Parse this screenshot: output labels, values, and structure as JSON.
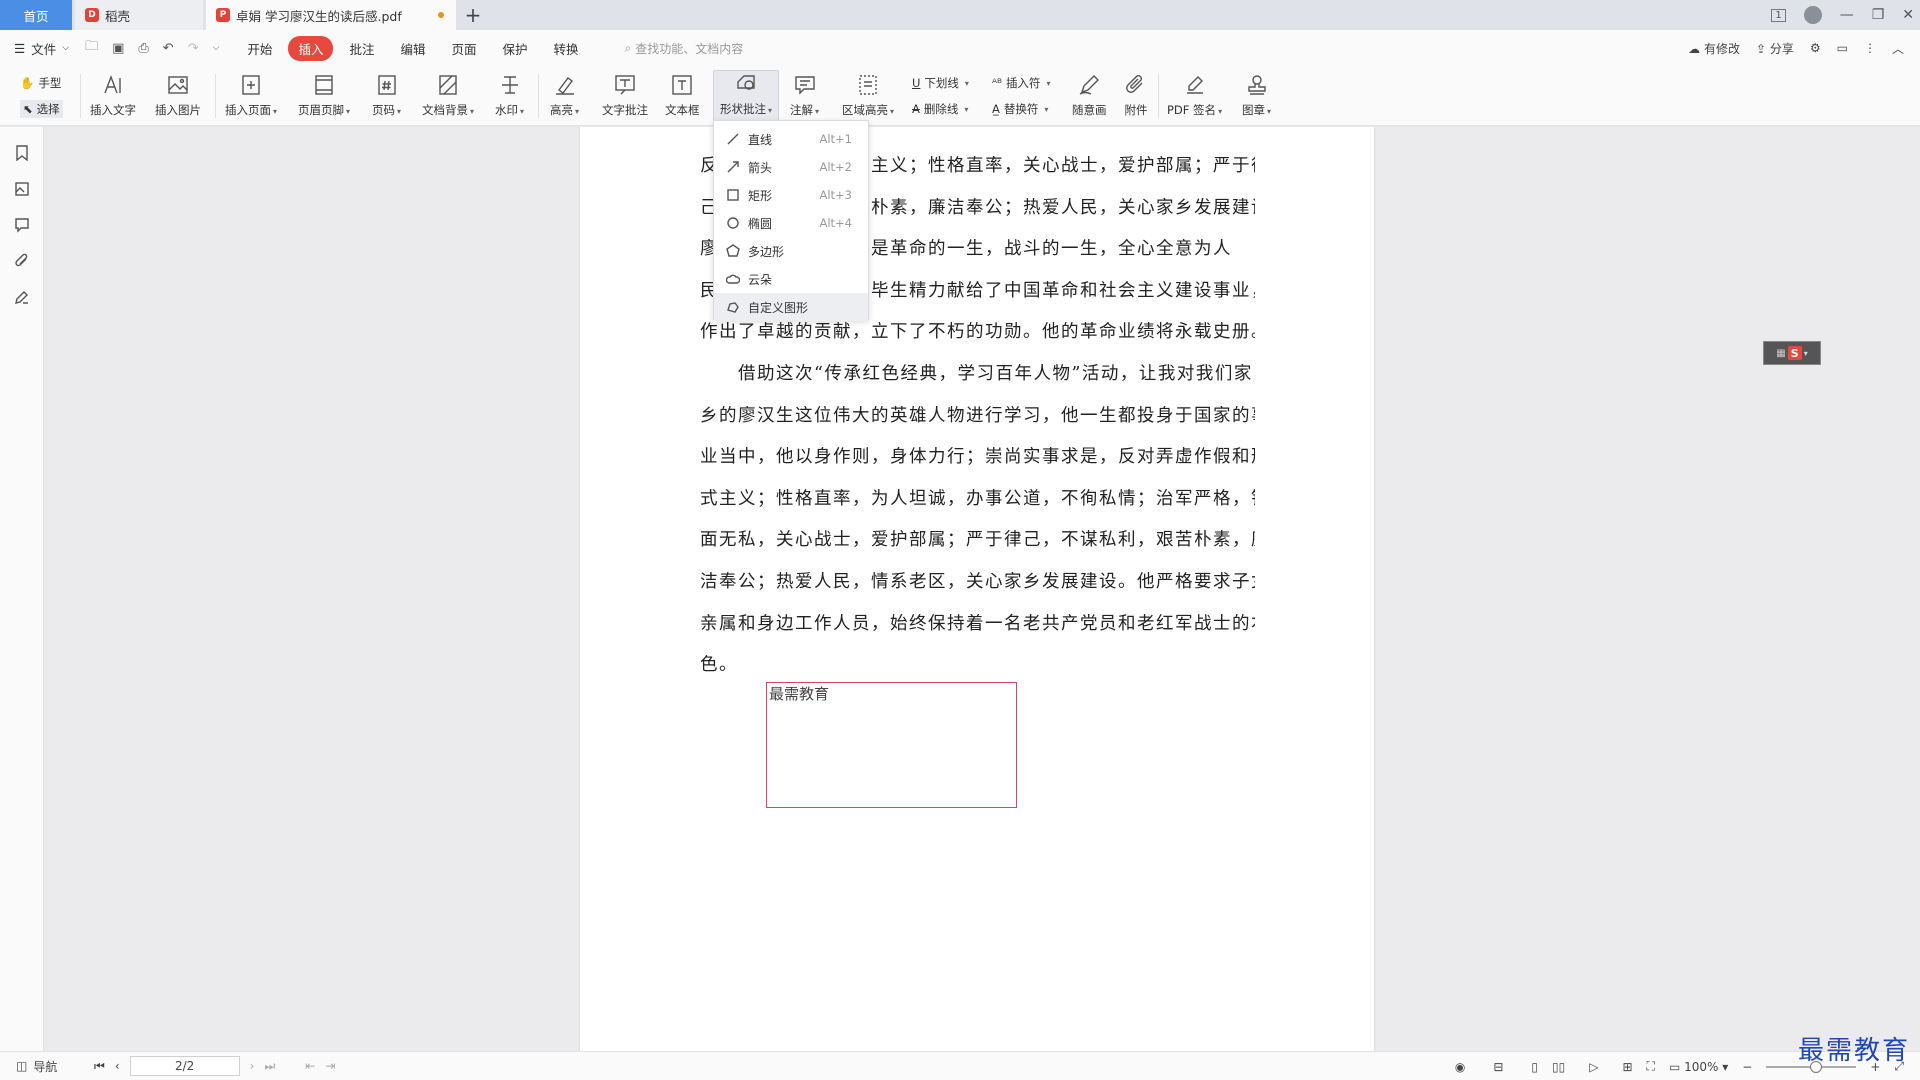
{
  "tabs": {
    "home": "首页",
    "daoke": "稻壳",
    "doc": "卓娟 学习廖汉生的读后感.pdf"
  },
  "window": {
    "page_indicator": "1"
  },
  "menubar": {
    "file": "文件",
    "tabs": [
      "开始",
      "插入",
      "批注",
      "编辑",
      "页面",
      "保护",
      "转换"
    ],
    "active_tab": "插入",
    "search_placeholder": "查找功能、文档内容",
    "has_changes": "有修改",
    "share": "分享"
  },
  "ribbon": {
    "hand": "手型",
    "select": "选择",
    "insert_text": "插入文字",
    "insert_image": "插入图片",
    "insert_page": "插入页面",
    "header_footer": "页眉页脚",
    "page_number": "页码",
    "doc_background": "文档背景",
    "watermark": "水印",
    "highlight": "高亮",
    "text_comment": "文字批注",
    "text_box": "文本框",
    "shape_comment": "形状批注",
    "note": "注解",
    "area_highlight": "区域高亮",
    "underline": "下划线",
    "strikethrough": "删除线",
    "insert_symbol": "插入符",
    "replace_symbol": "替换符",
    "freehand": "随意画",
    "attachment": "附件",
    "pdf_sign": "PDF 签名",
    "stamp": "图章"
  },
  "shape_menu": {
    "items": [
      {
        "label": "直线",
        "shortcut": "Alt+1"
      },
      {
        "label": "箭头",
        "shortcut": "Alt+2"
      },
      {
        "label": "矩形",
        "shortcut": "Alt+3"
      },
      {
        "label": "椭圆",
        "shortcut": "Alt+4"
      },
      {
        "label": "多边形",
        "shortcut": ""
      },
      {
        "label": "云朵",
        "shortcut": ""
      },
      {
        "label": "自定义图形",
        "shortcut": ""
      }
    ]
  },
  "document": {
    "lines": [
      "反对弄虚作假和形式主义；性格直率，关心战士，爱护部属；严于律",
      "己，不谋私利，艰苦朴素，廉洁奉公；热爱人民，关心家乡发展建设。",
      "廖汉生同志的一生，是革命的一生，战斗的一生，全心全意为人",
      "民服务的一生。他把毕生精力献给了中国革命和社会主义建设事业，",
      "作出了卓越的贡献，立下了不朽的功勋。他的革命业绩将永载史册。",
      "　　借助这次“传承红色经典，学习百年人物”活动，让我对我们家",
      "乡的廖汉生这位伟大的英雄人物进行学习，他一生都投身于国家的事",
      "业当中，他以身作则，身体力行；崇尚实事求是，反对弄虚作假和形",
      "式主义；性格直率，为人坦诚，办事公道，不徇私情；治军严格，铁",
      "面无私，关心战士，爱护部属；严于律己，不谋私利，艰苦朴素，廉",
      "洁奉公；热爱人民，情系老区，关心家乡发展建设。他严格要求子女",
      "亲属和身边工作人员，始终保持着一名老共产党员和老红军战士的本",
      "色。"
    ],
    "annotation_text": "最需教育"
  },
  "statusbar": {
    "nav": "导航",
    "page": "2/2",
    "zoom": "100%",
    "zoom_level": 0.55
  },
  "watermark": "最需教育",
  "colors": {
    "accent": "#e8493f",
    "home_tab": "#4a8ee6",
    "annotation": "#e0445a"
  }
}
